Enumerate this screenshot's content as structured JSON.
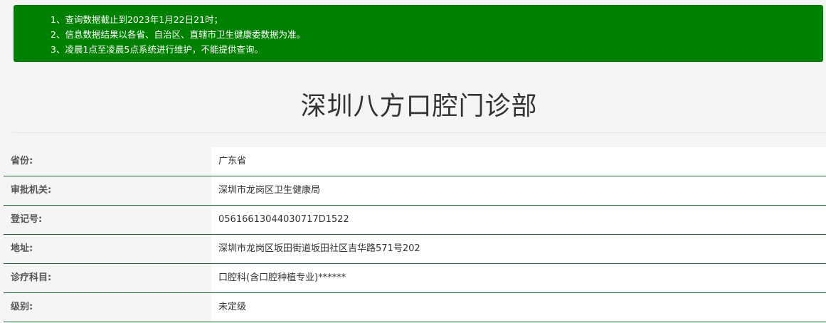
{
  "notice": {
    "lines": [
      "1、查询数据截止到2023年1月22日21时；",
      "2、信息数据结果以各省、自治区、直辖市卫生健康委数据为准。",
      "3、凌晨1点至凌晨5点系统进行维护，不能提供查询。"
    ]
  },
  "title": "深圳八方口腔门诊部",
  "fields": [
    {
      "label": "省份:",
      "value": "广东省"
    },
    {
      "label": "审批机关:",
      "value": "深圳市龙岗区卫生健康局"
    },
    {
      "label": "登记号:",
      "value": "05616613044030717D1522"
    },
    {
      "label": "地址:",
      "value": "深圳市龙岗区坂田街道坂田社区吉华路571号202"
    },
    {
      "label": "诊疗科目:",
      "value": "口腔科(含口腔种植专业)******"
    },
    {
      "label": "级别:",
      "value": "未定级"
    }
  ],
  "colors": {
    "notice_bg": "#008000",
    "row_divider": "#1b6b3a"
  }
}
